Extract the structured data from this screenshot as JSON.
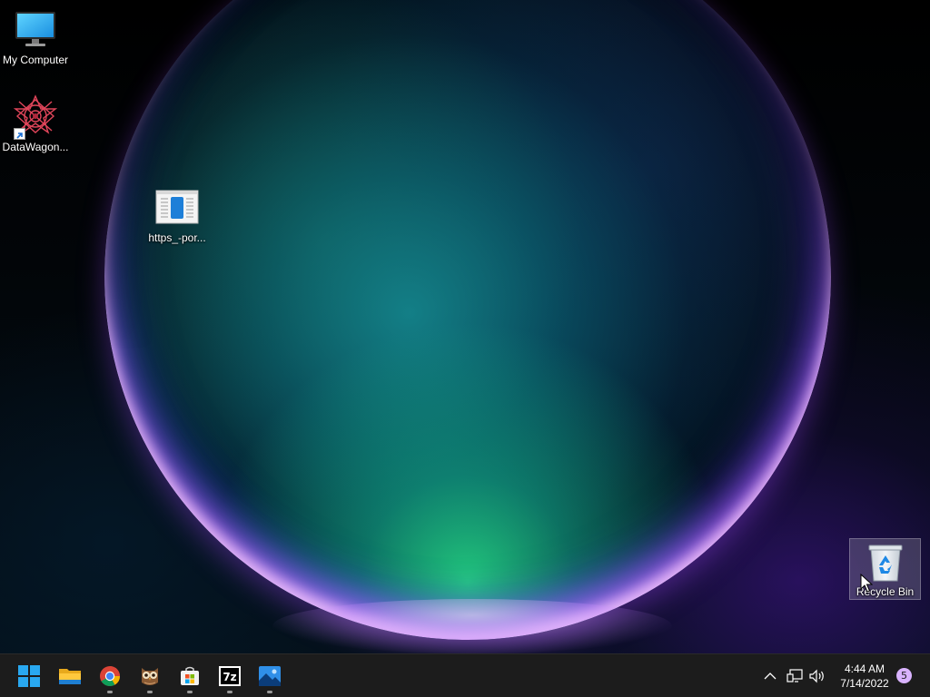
{
  "desktop": {
    "icons": [
      {
        "label": "My Computer",
        "icon": "monitor-icon"
      },
      {
        "label": "DataWagon...",
        "icon": "datawagon-app-icon",
        "shortcut": true
      },
      {
        "label": "https_-por...",
        "icon": "document-file-icon"
      },
      {
        "label": "Recycle Bin",
        "icon": "recycle-bin-icon",
        "selected": true
      }
    ]
  },
  "taskbar": {
    "pinned": [
      {
        "name": "Start",
        "icon": "windows-start-icon",
        "running": false
      },
      {
        "name": "File Explorer",
        "icon": "folder-icon",
        "running": false
      },
      {
        "name": "Google Chrome",
        "icon": "chrome-icon",
        "running": true
      },
      {
        "name": "Owl app",
        "icon": "owl-icon",
        "running": true
      },
      {
        "name": "Microsoft Store",
        "icon": "store-icon",
        "running": true
      },
      {
        "name": "7-Zip",
        "icon": "7zip-icon",
        "running": true
      },
      {
        "name": "Photos",
        "icon": "photos-icon",
        "running": true
      }
    ],
    "tray": {
      "icons": [
        "chevron-up-icon",
        "network-icon",
        "volume-icon"
      ],
      "time": "4:44 AM",
      "date": "7/14/2022",
      "notification_count": "5"
    }
  },
  "colors": {
    "taskbar_bg": "#1c1c1c",
    "accent_blue": "#29a8f0",
    "badge_bg": "#d9b3ff"
  }
}
